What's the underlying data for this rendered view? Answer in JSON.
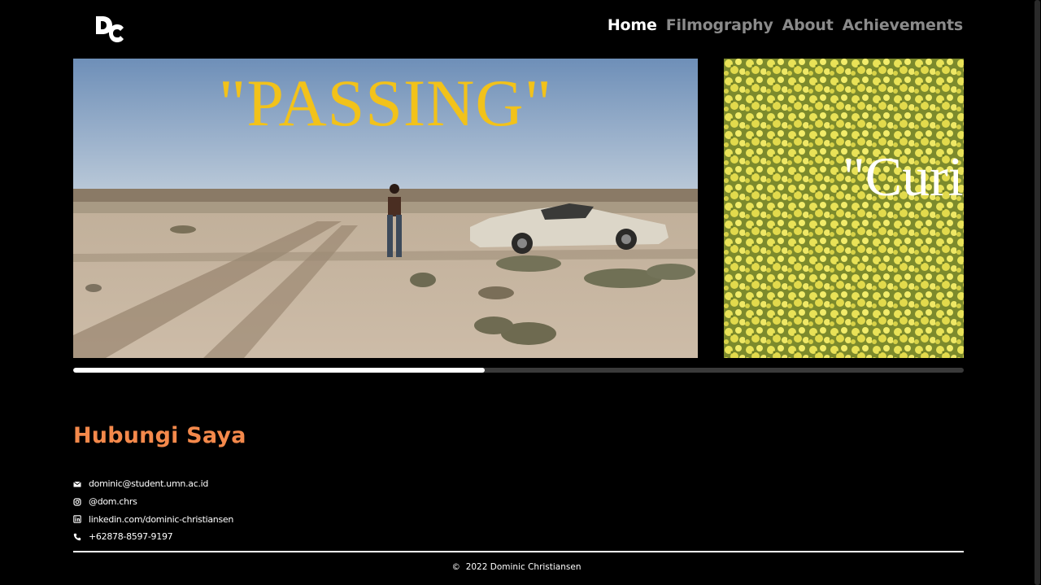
{
  "header": {
    "logo_text": "DC",
    "nav": [
      {
        "label": "Home",
        "active": true
      },
      {
        "label": "Filmography",
        "active": false
      },
      {
        "label": "About",
        "active": false
      },
      {
        "label": "Achievements",
        "active": false
      }
    ]
  },
  "carousel": {
    "slides": [
      {
        "title": "\"PASSING\"",
        "image": "desert-road-car-scene"
      },
      {
        "title": "\"Curi",
        "image": "yellow-flower-field"
      }
    ],
    "progress_fraction": 0.462
  },
  "contact": {
    "title": "Hubungi Saya",
    "items": [
      {
        "icon": "mail-icon",
        "text": "dominic@student.umn.ac.id"
      },
      {
        "icon": "instagram-icon",
        "text": "@dom.chrs"
      },
      {
        "icon": "linkedin-icon",
        "text": "linkedin.com/dominic-christiansen"
      },
      {
        "icon": "phone-icon",
        "text": "+62878-8597-9197"
      }
    ]
  },
  "footer": {
    "copyright_symbol": "©",
    "text": "2022 Dominic Christiansen"
  },
  "colors": {
    "background": "#000000",
    "accent": "#f4894b",
    "slide_title_1": "#f2c21a",
    "nav_inactive": "#8a8a8a"
  }
}
